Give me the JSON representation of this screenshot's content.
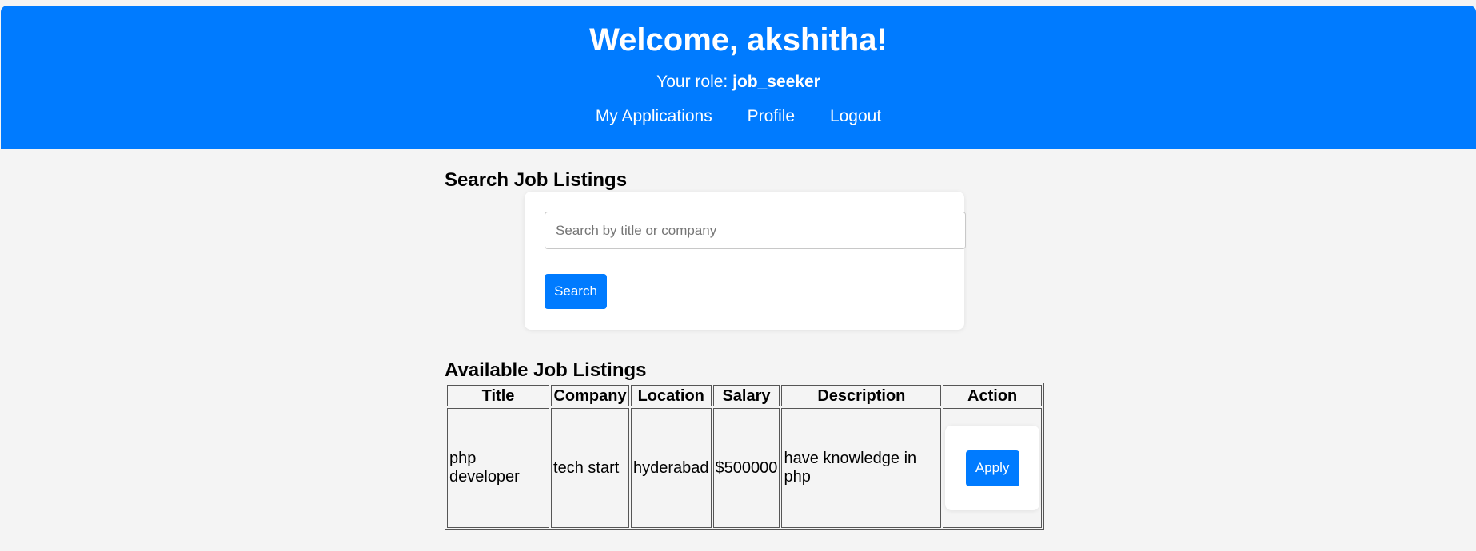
{
  "header": {
    "welcome": "Welcome, akshitha!",
    "role_label": "Your role:",
    "role_value": "job_seeker",
    "nav": [
      "My Applications",
      "Profile",
      "Logout"
    ],
    "bg_color": "#007bff"
  },
  "search": {
    "heading": "Search Job Listings",
    "placeholder": "Search by title or company",
    "value": "",
    "button_label": "Search"
  },
  "listings": {
    "heading": "Available Job Listings",
    "columns": [
      "Title",
      "Company",
      "Location",
      "Salary",
      "Description",
      "Action"
    ],
    "rows": [
      {
        "title": "php developer",
        "company": "tech start",
        "location": "hyderabad",
        "salary": "$500000",
        "description": "have knowledge in php",
        "action_label": "Apply"
      }
    ]
  }
}
